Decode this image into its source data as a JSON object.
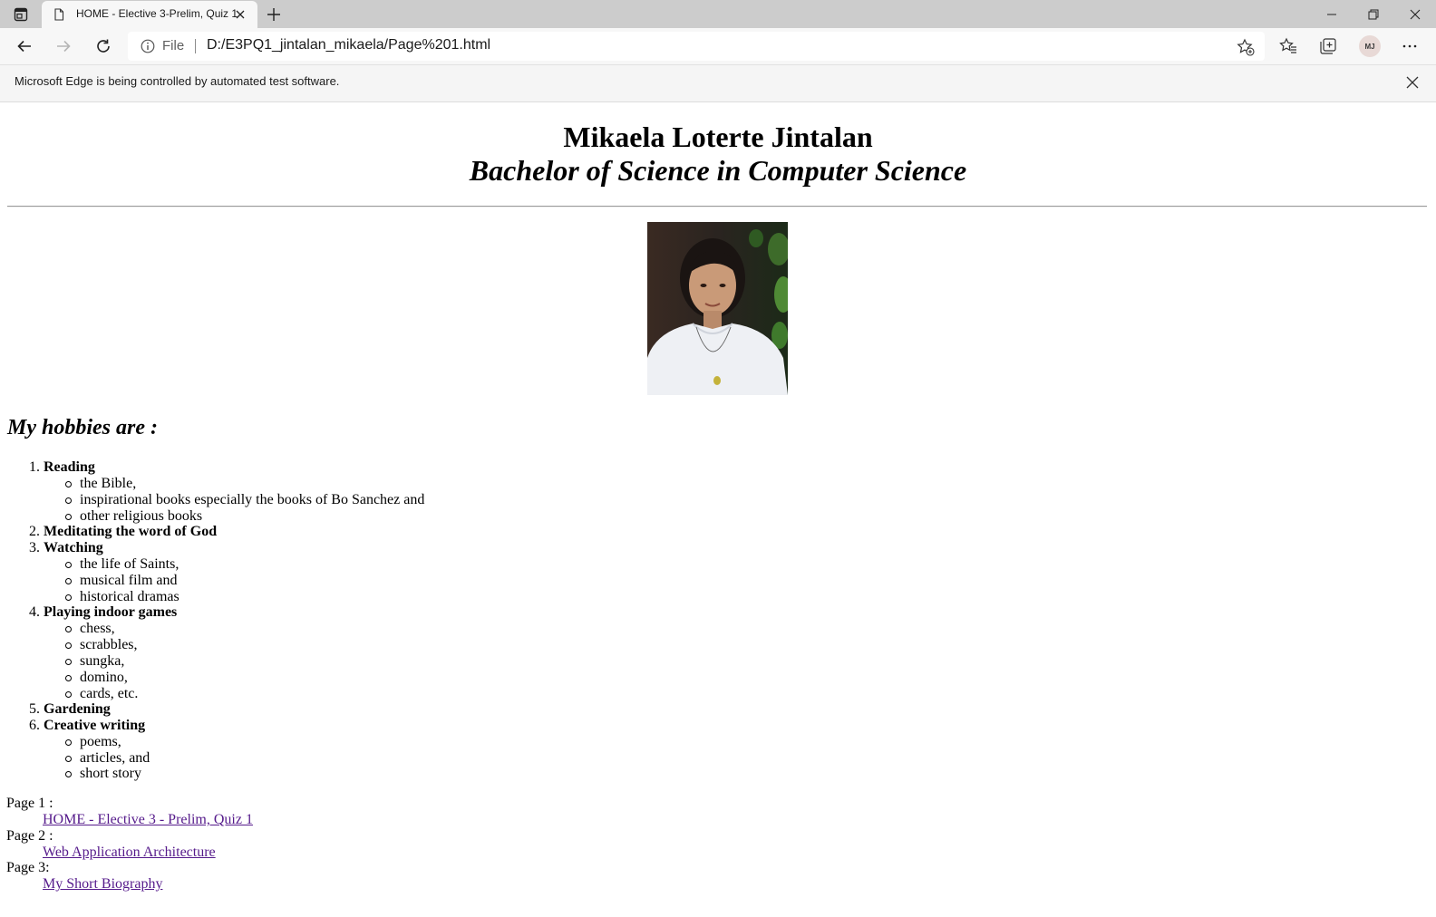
{
  "browser": {
    "tab_title": "HOME - Elective 3-Prelim, Quiz 1",
    "address_scheme": "File",
    "address_url": "D:/E3PQ1_jintalan_mikaela/Page%201.html",
    "profile_initials": "MJ",
    "infobar_message": "Microsoft Edge is being controlled by automated test software."
  },
  "page": {
    "name": "Mikaela Loterte Jintalan",
    "degree": "Bachelor of Science in Computer Science",
    "hobbies_title": "My hobbies are :",
    "hobbies": [
      {
        "num": "1.",
        "label": "Reading",
        "items": [
          "the Bible,",
          "inspirational books especially the books of Bo Sanchez and",
          "other religious books"
        ]
      },
      {
        "num": "2.",
        "label": "Meditating the word of God",
        "items": []
      },
      {
        "num": "3.",
        "label": "Watching",
        "items": [
          "the life of Saints,",
          "musical film and",
          "historical dramas"
        ]
      },
      {
        "num": "4.",
        "label": "Playing indoor games",
        "items": [
          "chess,",
          "scrabbles,",
          "sungka,",
          "domino,",
          "cards, etc."
        ]
      },
      {
        "num": "5.",
        "label": "Gardening",
        "items": []
      },
      {
        "num": "6.",
        "label": "Creative writing",
        "items": [
          "poems,",
          "articles, and",
          "short story"
        ]
      }
    ],
    "pages": [
      {
        "label": "Page 1 :",
        "link": "HOME - Elective 3 - Prelim, Quiz 1"
      },
      {
        "label": "Page 2 :",
        "link": "Web Application Architecture"
      },
      {
        "label": "Page 3:",
        "link": "My Short Biography"
      }
    ]
  }
}
